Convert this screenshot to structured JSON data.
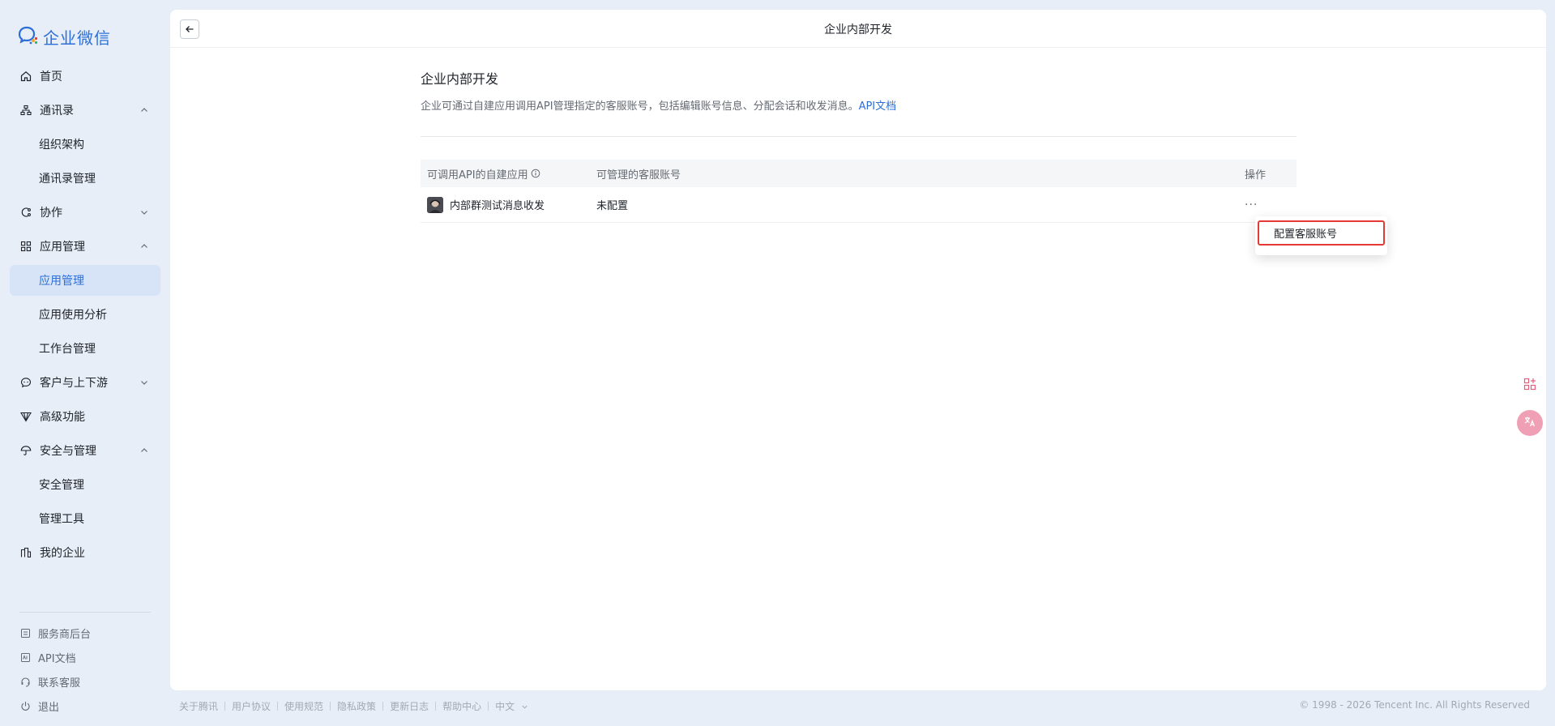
{
  "app": {
    "logo_text": "企业微信"
  },
  "sidebar": {
    "items": [
      {
        "label": "首页",
        "icon": "home-icon"
      },
      {
        "label": "通讯录",
        "icon": "org-chart-icon",
        "expanded": true,
        "children": [
          "组织架构",
          "通讯录管理"
        ]
      },
      {
        "label": "协作",
        "icon": "collaboration-icon",
        "expanded": false
      },
      {
        "label": "应用管理",
        "icon": "apps-grid-icon",
        "expanded": true,
        "children": [
          "应用管理",
          "应用使用分析",
          "工作台管理"
        ],
        "active_child": "应用管理"
      },
      {
        "label": "客户与上下游",
        "icon": "chat-bubble-icon",
        "expanded": false
      },
      {
        "label": "高级功能",
        "icon": "diamond-icon"
      },
      {
        "label": "安全与管理",
        "icon": "umbrella-icon",
        "expanded": true,
        "children": [
          "安全管理",
          "管理工具"
        ]
      },
      {
        "label": "我的企业",
        "icon": "building-icon"
      }
    ],
    "bottom": [
      {
        "label": "服务商后台",
        "icon": "doc-list-icon"
      },
      {
        "label": "API文档",
        "icon": "api-doc-icon"
      },
      {
        "label": "联系客服",
        "icon": "headset-icon"
      },
      {
        "label": "退出",
        "icon": "power-icon"
      }
    ]
  },
  "header": {
    "title": "企业内部开发"
  },
  "section": {
    "title": "企业内部开发",
    "description": "企业可通过自建应用调用API管理指定的客服账号，包括编辑账号信息、分配会话和收发消息。",
    "doc_link": "API文档"
  },
  "table": {
    "columns": [
      "可调用API的自建应用",
      "可管理的客服账号",
      "操作"
    ],
    "rows": [
      {
        "app_name": "内部群测试消息收发",
        "accounts": "未配置",
        "action": "···"
      }
    ]
  },
  "dropdown": {
    "item": "配置客服账号"
  },
  "footer": {
    "links": [
      "关于腾讯",
      "用户协议",
      "使用规范",
      "隐私政策",
      "更新日志",
      "帮助中心"
    ],
    "language": "中文",
    "copyright": "© 1998 - 2026 Tencent Inc. All Rights Reserved"
  },
  "colors": {
    "accent": "#2d6fd8",
    "highlight_border": "#e53935"
  }
}
